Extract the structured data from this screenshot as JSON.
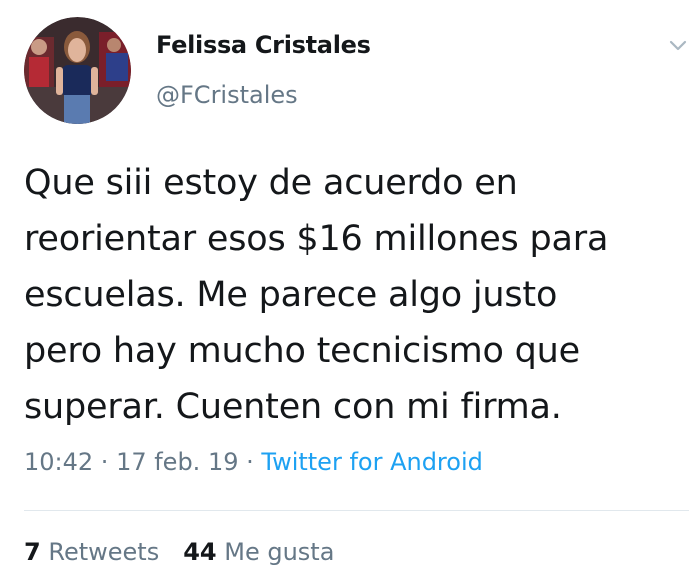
{
  "author": {
    "name": "Felissa Cristales",
    "handle": "@FCristales"
  },
  "tweet": {
    "lines": [
      "Que siii estoy de acuerdo en",
      "reorientar esos $16 millones para",
      "escuelas. Me parece algo justo",
      "pero hay mucho tecnicismo que",
      "superar. Cuenten con mi firma."
    ],
    "time": "10:42",
    "date": "17 feb. 19",
    "separator": " · ",
    "source": "Twitter for Android"
  },
  "stats": {
    "retweets_count": "7",
    "retweets_label": "Retweets",
    "likes_count": "44",
    "likes_label": "Me gusta"
  },
  "colors": {
    "text": "#14171a",
    "secondary": "#657786",
    "link": "#1da1f2",
    "divider": "#e1e8ed"
  },
  "icons": {
    "menu": "chevron-down-icon"
  }
}
